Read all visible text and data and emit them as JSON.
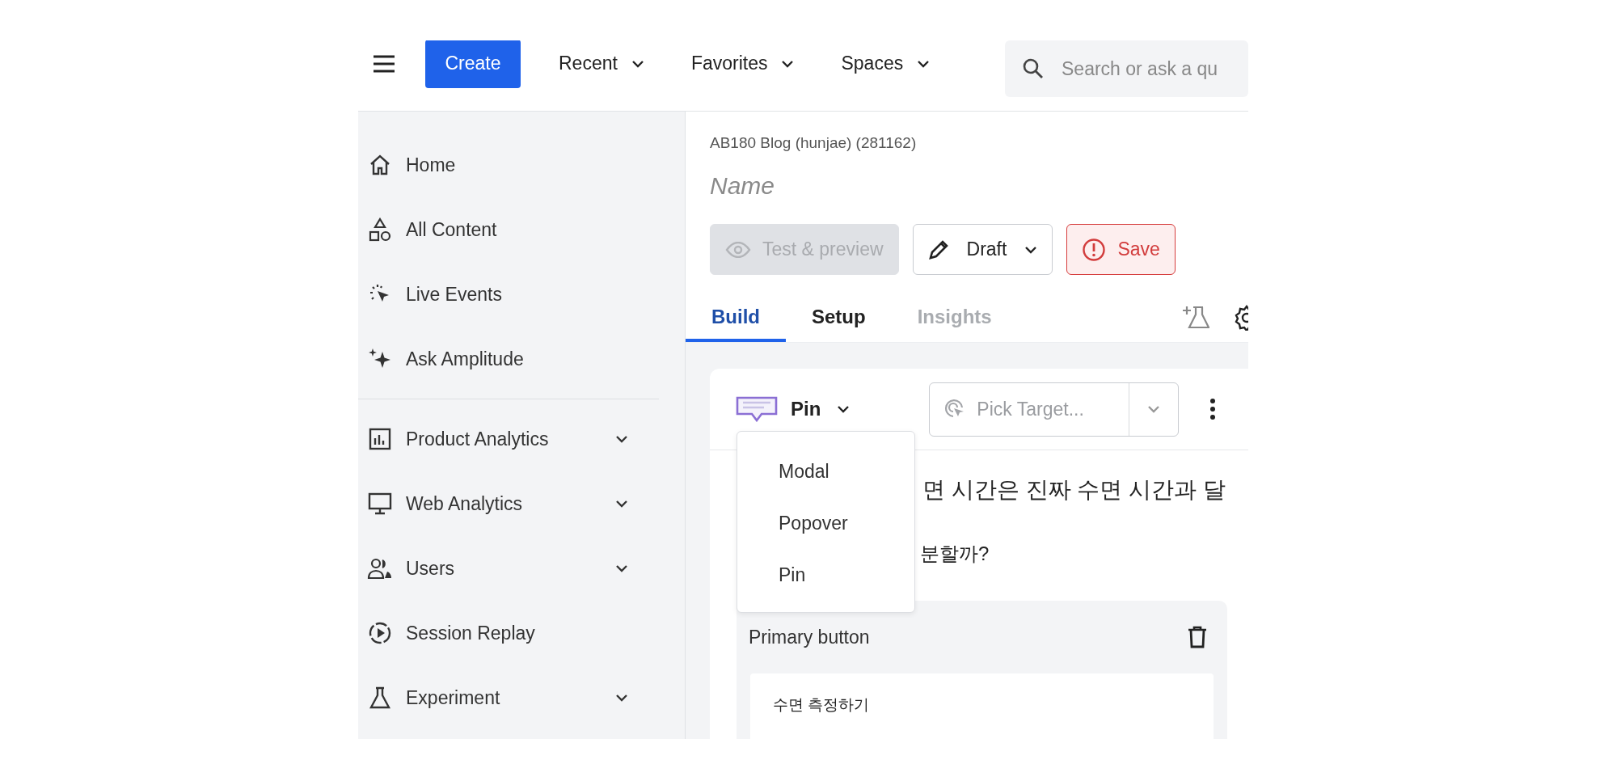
{
  "topbar": {
    "create": "Create",
    "menus": [
      {
        "label": "Recent"
      },
      {
        "label": "Favorites"
      },
      {
        "label": "Spaces"
      }
    ],
    "search": {
      "placeholder": "Search or ask a qu"
    }
  },
  "sidebar": {
    "sections": [
      {
        "items": [
          {
            "label": "Home",
            "has_submenu": false
          },
          {
            "label": "All Content",
            "has_submenu": false
          },
          {
            "label": "Live Events",
            "has_submenu": false
          },
          {
            "label": "Ask Amplitude",
            "has_submenu": false
          }
        ]
      },
      {
        "items": [
          {
            "label": "Product Analytics",
            "has_submenu": true
          },
          {
            "label": "Web Analytics",
            "has_submenu": true
          },
          {
            "label": "Users",
            "has_submenu": true
          },
          {
            "label": "Session Replay",
            "has_submenu": false
          },
          {
            "label": "Experiment",
            "has_submenu": true
          }
        ]
      }
    ]
  },
  "editor": {
    "breadcrumb": "AB180 Blog (hunjae) (281162)",
    "name_field": {
      "placeholder": "Name"
    },
    "actions": [
      {
        "label": "Test & preview",
        "kind": "preview",
        "disabled": true
      },
      {
        "label": "Draft",
        "kind": "status",
        "disabled": false
      },
      {
        "label": "Save",
        "kind": "save",
        "disabled": false
      }
    ],
    "tabs": [
      {
        "label": "Build",
        "selected": true,
        "disabled": false
      },
      {
        "label": "Setup",
        "selected": false,
        "disabled": false
      },
      {
        "label": "Insights",
        "selected": false,
        "disabled": true
      }
    ],
    "card": {
      "type_select": {
        "label": "Pin",
        "expanded": true
      },
      "type_menu": [
        {
          "label": "Modal"
        },
        {
          "label": "Popover"
        },
        {
          "label": "Pin"
        }
      ],
      "target": {
        "placeholder": "Pick Target..."
      },
      "body_lines": [
        "면 시간은 진짜 수면 시간과 달",
        "분할까?"
      ],
      "primary_button": {
        "title": "Primary button",
        "text": "수면 측정하기"
      }
    }
  }
}
